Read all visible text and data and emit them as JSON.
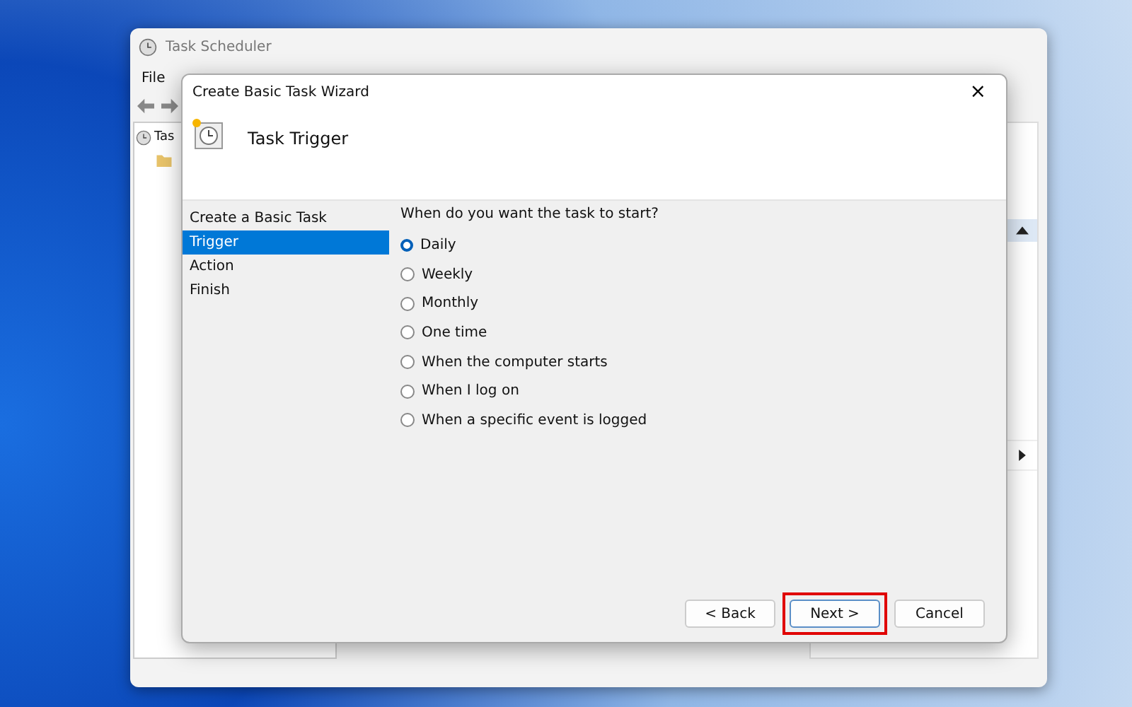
{
  "background_window": {
    "title": "Task Scheduler",
    "menu": [
      "File"
    ],
    "tree_item": "Tas"
  },
  "wizard": {
    "title": "Create Basic Task Wizard",
    "close": "×",
    "heading": "Task Trigger",
    "steps": [
      {
        "label": "Create a Basic Task",
        "selected": false
      },
      {
        "label": "Trigger",
        "selected": true
      },
      {
        "label": "Action",
        "selected": false
      },
      {
        "label": "Finish",
        "selected": false
      }
    ],
    "question": "When do you want the task to start?",
    "options": [
      {
        "label": "Daily",
        "selected": true
      },
      {
        "label": "Weekly",
        "selected": false
      },
      {
        "label": "Monthly",
        "selected": false
      },
      {
        "label": "One time",
        "selected": false
      },
      {
        "label": "When the computer starts",
        "selected": false
      },
      {
        "label": "When I log on",
        "selected": false
      },
      {
        "label": "When a specific event is logged",
        "selected": false
      }
    ],
    "buttons": [
      {
        "label": "< Back",
        "highlighted": false
      },
      {
        "label": "Next >",
        "highlighted": true
      },
      {
        "label": "Cancel",
        "highlighted": false
      }
    ]
  }
}
